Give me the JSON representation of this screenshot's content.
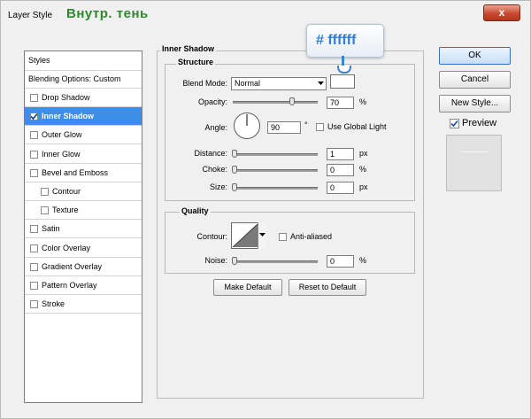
{
  "window": {
    "title": "Layer Style",
    "annotation": "Внутр. тень",
    "close_glyph": "x"
  },
  "styles_panel": {
    "header": "Styles",
    "blending": "Blending Options: Custom",
    "items": [
      {
        "label": "Drop Shadow",
        "checked": false,
        "selected": false,
        "indent": false
      },
      {
        "label": "Inner Shadow",
        "checked": true,
        "selected": true,
        "indent": false
      },
      {
        "label": "Outer Glow",
        "checked": false,
        "selected": false,
        "indent": false
      },
      {
        "label": "Inner Glow",
        "checked": false,
        "selected": false,
        "indent": false
      },
      {
        "label": "Bevel and Emboss",
        "checked": false,
        "selected": false,
        "indent": false
      },
      {
        "label": "Contour",
        "checked": false,
        "selected": false,
        "indent": true
      },
      {
        "label": "Texture",
        "checked": false,
        "selected": false,
        "indent": true
      },
      {
        "label": "Satin",
        "checked": false,
        "selected": false,
        "indent": false
      },
      {
        "label": "Color Overlay",
        "checked": false,
        "selected": false,
        "indent": false
      },
      {
        "label": "Gradient Overlay",
        "checked": false,
        "selected": false,
        "indent": false
      },
      {
        "label": "Pattern Overlay",
        "checked": false,
        "selected": false,
        "indent": false
      },
      {
        "label": "Stroke",
        "checked": false,
        "selected": false,
        "indent": false
      }
    ]
  },
  "inner_shadow": {
    "title": "Inner Shadow",
    "structure": {
      "title": "Structure",
      "blend_mode_label": "Blend Mode:",
      "blend_mode_value": "Normal",
      "opacity_label": "Opacity:",
      "opacity_value": "70",
      "opacity_unit": "%",
      "opacity_level": 0.7,
      "angle_label": "Angle:",
      "angle_value": "90",
      "angle_unit": "°",
      "use_global_light_label": "Use Global Light",
      "use_global_light": false,
      "distance_label": "Distance:",
      "distance_value": "1",
      "distance_unit": "px",
      "choke_label": "Choke:",
      "choke_value": "0",
      "choke_unit": "%",
      "size_label": "Size:",
      "size_value": "0",
      "size_unit": "px"
    },
    "quality": {
      "title": "Quality",
      "contour_label": "Contour:",
      "anti_aliased_label": "Anti-aliased",
      "anti_aliased": false,
      "noise_label": "Noise:",
      "noise_value": "0",
      "noise_unit": "%"
    },
    "make_default": "Make Default",
    "reset_default": "Reset to Default"
  },
  "color_callout": {
    "text": "# ffffff",
    "color": "#ffffff"
  },
  "right": {
    "ok": "OK",
    "cancel": "Cancel",
    "new_style": "New Style...",
    "preview_label": "Preview",
    "preview_checked": true
  },
  "colors": {
    "selection": "#3d8ee9",
    "annotation": "#2c8a2c",
    "callout_text": "#2f7ed8"
  }
}
